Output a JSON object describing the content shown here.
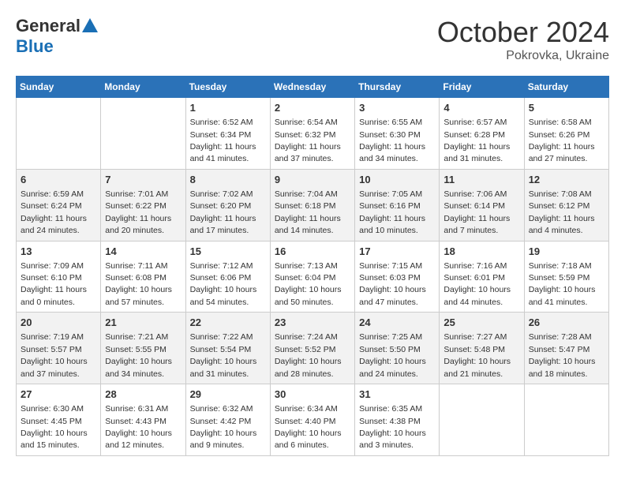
{
  "logo": {
    "general": "General",
    "blue": "Blue"
  },
  "title": {
    "month_year": "October 2024",
    "location": "Pokrovka, Ukraine"
  },
  "weekdays": [
    "Sunday",
    "Monday",
    "Tuesday",
    "Wednesday",
    "Thursday",
    "Friday",
    "Saturday"
  ],
  "weeks": [
    [
      {
        "day": "",
        "info": ""
      },
      {
        "day": "",
        "info": ""
      },
      {
        "day": "1",
        "info": "Sunrise: 6:52 AM\nSunset: 6:34 PM\nDaylight: 11 hours and 41 minutes."
      },
      {
        "day": "2",
        "info": "Sunrise: 6:54 AM\nSunset: 6:32 PM\nDaylight: 11 hours and 37 minutes."
      },
      {
        "day": "3",
        "info": "Sunrise: 6:55 AM\nSunset: 6:30 PM\nDaylight: 11 hours and 34 minutes."
      },
      {
        "day": "4",
        "info": "Sunrise: 6:57 AM\nSunset: 6:28 PM\nDaylight: 11 hours and 31 minutes."
      },
      {
        "day": "5",
        "info": "Sunrise: 6:58 AM\nSunset: 6:26 PM\nDaylight: 11 hours and 27 minutes."
      }
    ],
    [
      {
        "day": "6",
        "info": "Sunrise: 6:59 AM\nSunset: 6:24 PM\nDaylight: 11 hours and 24 minutes."
      },
      {
        "day": "7",
        "info": "Sunrise: 7:01 AM\nSunset: 6:22 PM\nDaylight: 11 hours and 20 minutes."
      },
      {
        "day": "8",
        "info": "Sunrise: 7:02 AM\nSunset: 6:20 PM\nDaylight: 11 hours and 17 minutes."
      },
      {
        "day": "9",
        "info": "Sunrise: 7:04 AM\nSunset: 6:18 PM\nDaylight: 11 hours and 14 minutes."
      },
      {
        "day": "10",
        "info": "Sunrise: 7:05 AM\nSunset: 6:16 PM\nDaylight: 11 hours and 10 minutes."
      },
      {
        "day": "11",
        "info": "Sunrise: 7:06 AM\nSunset: 6:14 PM\nDaylight: 11 hours and 7 minutes."
      },
      {
        "day": "12",
        "info": "Sunrise: 7:08 AM\nSunset: 6:12 PM\nDaylight: 11 hours and 4 minutes."
      }
    ],
    [
      {
        "day": "13",
        "info": "Sunrise: 7:09 AM\nSunset: 6:10 PM\nDaylight: 11 hours and 0 minutes."
      },
      {
        "day": "14",
        "info": "Sunrise: 7:11 AM\nSunset: 6:08 PM\nDaylight: 10 hours and 57 minutes."
      },
      {
        "day": "15",
        "info": "Sunrise: 7:12 AM\nSunset: 6:06 PM\nDaylight: 10 hours and 54 minutes."
      },
      {
        "day": "16",
        "info": "Sunrise: 7:13 AM\nSunset: 6:04 PM\nDaylight: 10 hours and 50 minutes."
      },
      {
        "day": "17",
        "info": "Sunrise: 7:15 AM\nSunset: 6:03 PM\nDaylight: 10 hours and 47 minutes."
      },
      {
        "day": "18",
        "info": "Sunrise: 7:16 AM\nSunset: 6:01 PM\nDaylight: 10 hours and 44 minutes."
      },
      {
        "day": "19",
        "info": "Sunrise: 7:18 AM\nSunset: 5:59 PM\nDaylight: 10 hours and 41 minutes."
      }
    ],
    [
      {
        "day": "20",
        "info": "Sunrise: 7:19 AM\nSunset: 5:57 PM\nDaylight: 10 hours and 37 minutes."
      },
      {
        "day": "21",
        "info": "Sunrise: 7:21 AM\nSunset: 5:55 PM\nDaylight: 10 hours and 34 minutes."
      },
      {
        "day": "22",
        "info": "Sunrise: 7:22 AM\nSunset: 5:54 PM\nDaylight: 10 hours and 31 minutes."
      },
      {
        "day": "23",
        "info": "Sunrise: 7:24 AM\nSunset: 5:52 PM\nDaylight: 10 hours and 28 minutes."
      },
      {
        "day": "24",
        "info": "Sunrise: 7:25 AM\nSunset: 5:50 PM\nDaylight: 10 hours and 24 minutes."
      },
      {
        "day": "25",
        "info": "Sunrise: 7:27 AM\nSunset: 5:48 PM\nDaylight: 10 hours and 21 minutes."
      },
      {
        "day": "26",
        "info": "Sunrise: 7:28 AM\nSunset: 5:47 PM\nDaylight: 10 hours and 18 minutes."
      }
    ],
    [
      {
        "day": "27",
        "info": "Sunrise: 6:30 AM\nSunset: 4:45 PM\nDaylight: 10 hours and 15 minutes."
      },
      {
        "day": "28",
        "info": "Sunrise: 6:31 AM\nSunset: 4:43 PM\nDaylight: 10 hours and 12 minutes."
      },
      {
        "day": "29",
        "info": "Sunrise: 6:32 AM\nSunset: 4:42 PM\nDaylight: 10 hours and 9 minutes."
      },
      {
        "day": "30",
        "info": "Sunrise: 6:34 AM\nSunset: 4:40 PM\nDaylight: 10 hours and 6 minutes."
      },
      {
        "day": "31",
        "info": "Sunrise: 6:35 AM\nSunset: 4:38 PM\nDaylight: 10 hours and 3 minutes."
      },
      {
        "day": "",
        "info": ""
      },
      {
        "day": "",
        "info": ""
      }
    ]
  ]
}
